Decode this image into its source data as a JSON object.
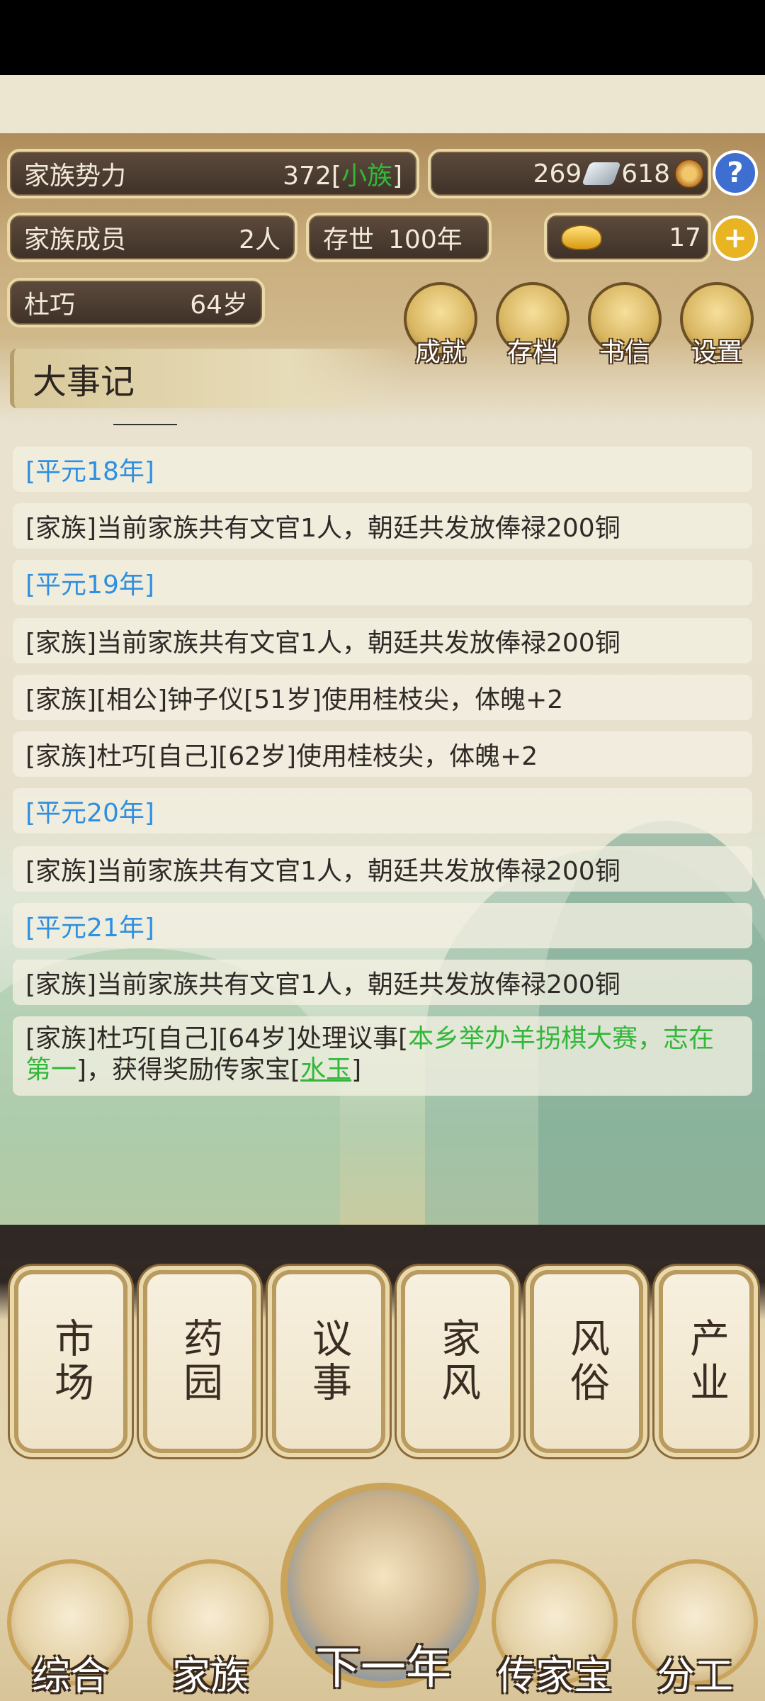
{
  "stats": {
    "power_label": "家族势力",
    "power_value": "372",
    "power_rank_open": "[",
    "power_rank": "小族",
    "power_rank_close": "]",
    "silver": "269",
    "copper": "618",
    "members_label": "家族成员",
    "members_value": "2人",
    "existence_label": "存世",
    "existence_value": "100年",
    "gold": "17",
    "character_name": "杜巧",
    "character_age": "64岁"
  },
  "menu_icons": [
    {
      "label": "成就",
      "icon": "achievement-icon"
    },
    {
      "label": "存档",
      "icon": "save-icon"
    },
    {
      "label": "书信",
      "icon": "letter-icon"
    },
    {
      "label": "设置",
      "icon": "settings-icon"
    }
  ],
  "chronicle": {
    "title": "大事记",
    "entries": [
      {
        "text": "[平元18年]"
      },
      {
        "text": "[家族]当前家族共有文官1人，朝廷共发放俸禄200铜"
      },
      {
        "text": "[平元19年]"
      },
      {
        "text": "[家族]当前家族共有文官1人，朝廷共发放俸禄200铜"
      },
      {
        "text": "[家族][相公]钟子仪[51岁]使用桂枝尖，体魄+2"
      },
      {
        "text": "[家族]杜巧[自己][62岁]使用桂枝尖，体魄+2"
      },
      {
        "text": "[平元20年]"
      },
      {
        "text": "[家族]当前家族共有文官1人，朝廷共发放俸禄200铜"
      },
      {
        "text": "[平元21年]"
      },
      {
        "text": "[家族]当前家族共有文官1人，朝廷共发放俸禄200铜"
      }
    ],
    "last_entry": {
      "prefix": "[家族]杜巧[自己][64岁]处理议事[",
      "event": "本乡举办羊拐棋大赛，志在第一",
      "middle": "]，获得奖励传家宝[",
      "reward": "水玉",
      "suffix": "]"
    }
  },
  "functions": [
    {
      "label": "市场"
    },
    {
      "label": "药园"
    },
    {
      "label": "议事"
    },
    {
      "label": "家风"
    },
    {
      "label": "风俗"
    },
    {
      "label": "产业"
    }
  ],
  "bottom_nav": {
    "overview": "综合",
    "family": "家族",
    "next_year": "下一年",
    "heirloom": "传家宝",
    "division": "分工"
  }
}
